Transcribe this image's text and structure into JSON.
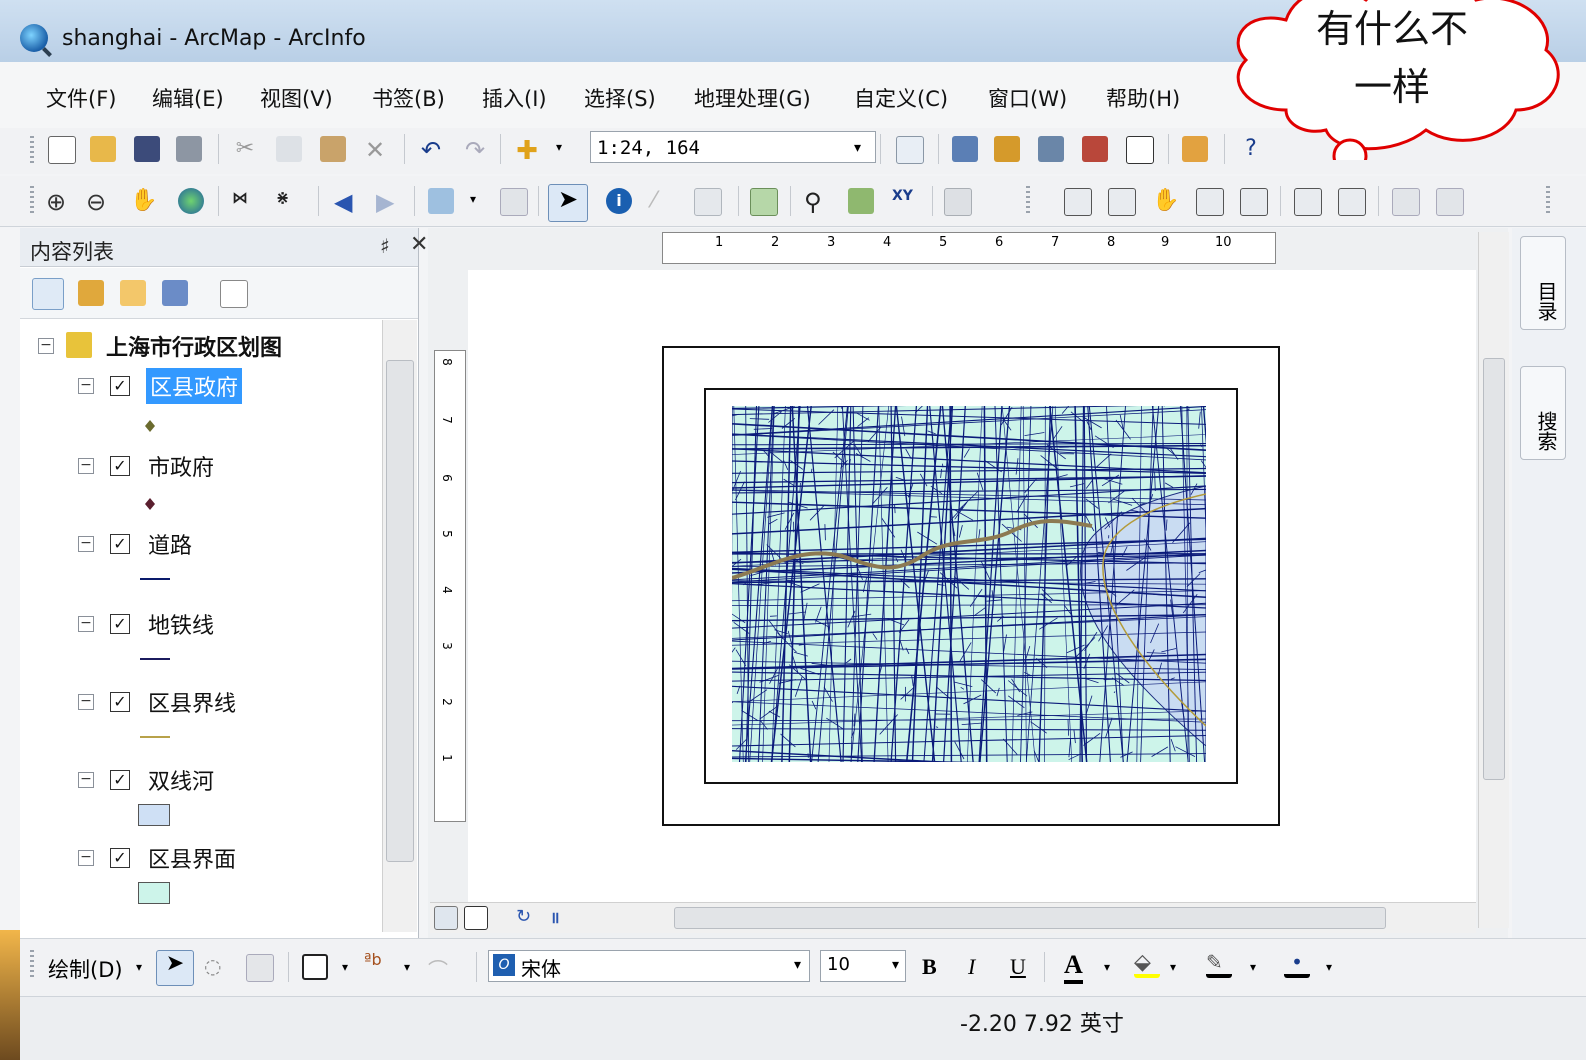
{
  "window": {
    "title": "shanghai - ArcMap - ArcInfo"
  },
  "menu": [
    "文件(F)",
    "编辑(E)",
    "视图(V)",
    "书签(B)",
    "插入(I)",
    "选择(S)",
    "地理处理(G)",
    "自定义(C)",
    "窗口(W)",
    "帮助(H)"
  ],
  "toolbar": {
    "scale": "1:24, 164"
  },
  "toc": {
    "title": "内容列表",
    "pin": "♯",
    "close": "✕",
    "root": "上海市行政区划图",
    "layers": [
      {
        "name": "区县政府",
        "checked": true,
        "selected": true,
        "symbol": "point",
        "color": "#6b6b2e"
      },
      {
        "name": "市政府",
        "checked": true,
        "selected": false,
        "symbol": "point",
        "color": "#5a1e2e"
      },
      {
        "name": "道路",
        "checked": true,
        "selected": false,
        "symbol": "line",
        "color": "#0a1a6b"
      },
      {
        "name": "地铁线",
        "checked": true,
        "selected": false,
        "symbol": "line",
        "color": "#1b1b5e"
      },
      {
        "name": "区县界线",
        "checked": true,
        "selected": false,
        "symbol": "line",
        "color": "#b8a24a"
      },
      {
        "name": "双线河",
        "checked": true,
        "selected": false,
        "symbol": "polygon",
        "color": "#cfe0f5"
      },
      {
        "name": "区县界面",
        "checked": true,
        "selected": false,
        "symbol": "polygon",
        "color": "#cdf4ea"
      }
    ]
  },
  "ruler": {
    "horizontal": [
      "1",
      "2",
      "3",
      "4",
      "5",
      "6",
      "7",
      "8",
      "9",
      "10"
    ],
    "vertical": [
      "8",
      "7",
      "6",
      "5",
      "4",
      "3",
      "2",
      "1"
    ]
  },
  "side_tabs": [
    "目录",
    "搜索"
  ],
  "draw": {
    "label": "绘制(D)",
    "font": "宋体",
    "size": "10",
    "bold": "B",
    "italic": "I",
    "underline": "U",
    "font_color": "A"
  },
  "status": {
    "coords": "-2.20  7.92 英寸"
  },
  "callout": {
    "line1": "有什么不",
    "line2": "一样"
  },
  "colors": {
    "map_fill": "#cdf4ea",
    "road": "#0a1a7a",
    "river": "#c9dcf2",
    "boundary": "#b39b3a"
  }
}
